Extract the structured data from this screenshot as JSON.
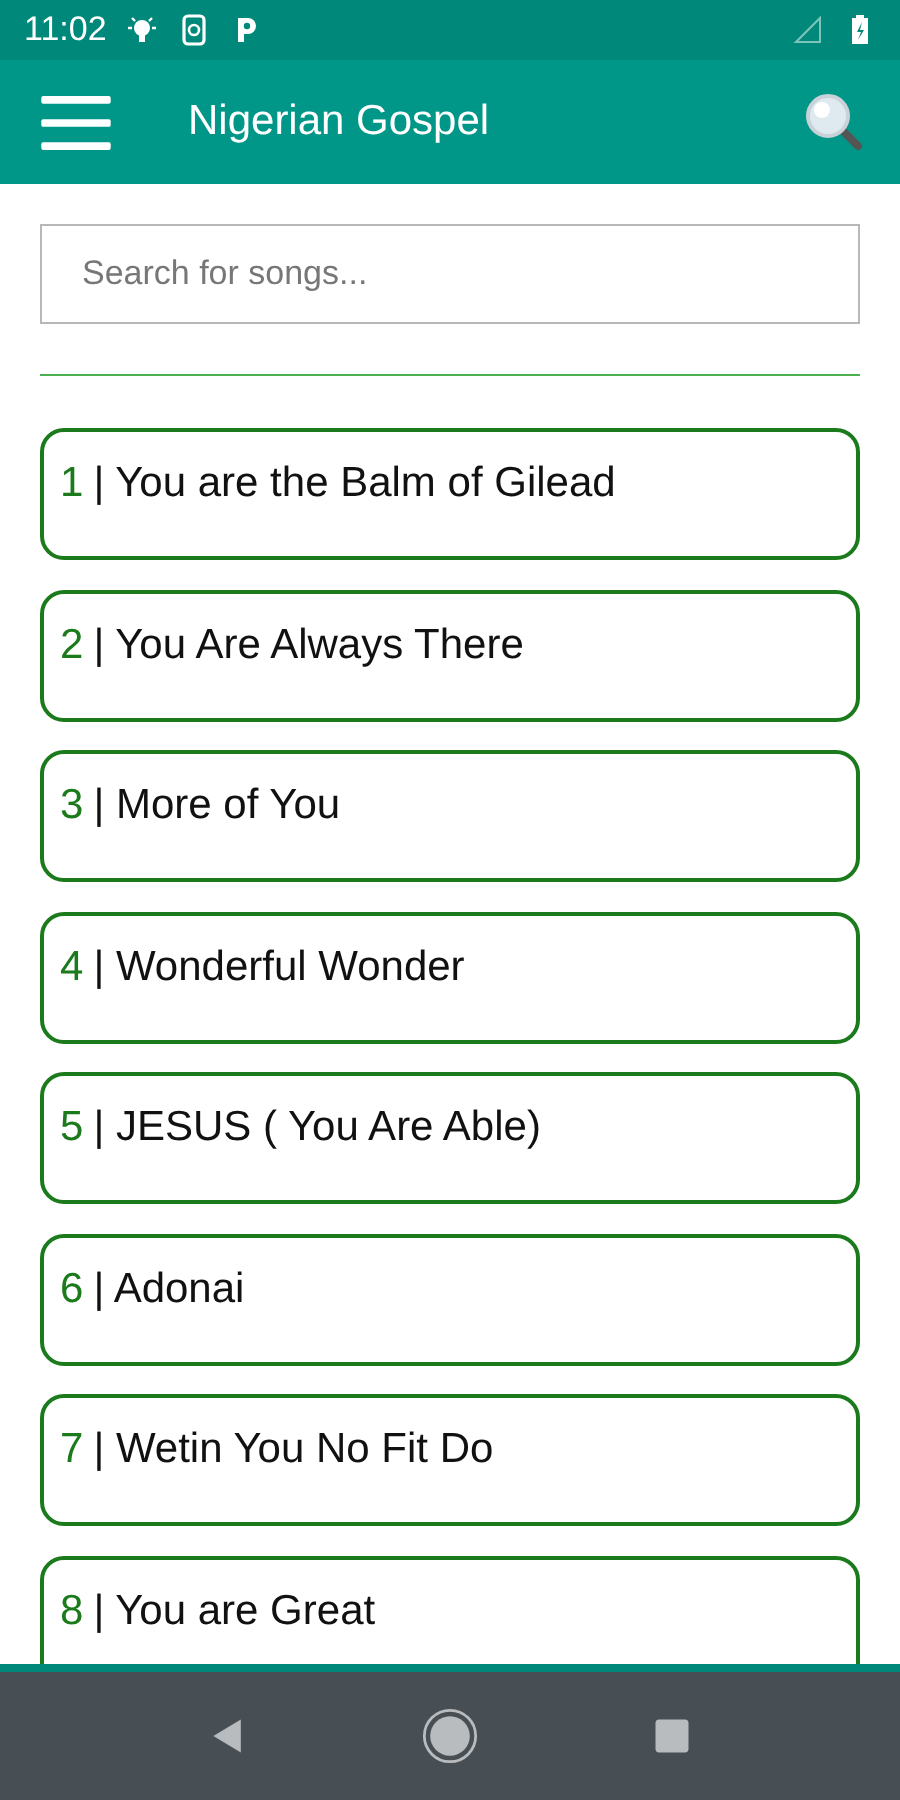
{
  "status_bar": {
    "time": "11:02"
  },
  "toolbar": {
    "title": "Nigerian Gospel"
  },
  "search": {
    "placeholder": "Search for songs..."
  },
  "songs": [
    {
      "number": "1",
      "title": "| You are the Balm of Gilead"
    },
    {
      "number": "2",
      "title": "| You Are Always There"
    },
    {
      "number": "3",
      "title": "| More of You"
    },
    {
      "number": "4",
      "title": "| Wonderful Wonder"
    },
    {
      "number": "5",
      "title": "| JESUS ( You Are Able)"
    },
    {
      "number": "6",
      "title": "| Adonai"
    },
    {
      "number": "7",
      "title": "| Wetin You No Fit Do"
    },
    {
      "number": "8",
      "title": "| You are Great"
    }
  ]
}
